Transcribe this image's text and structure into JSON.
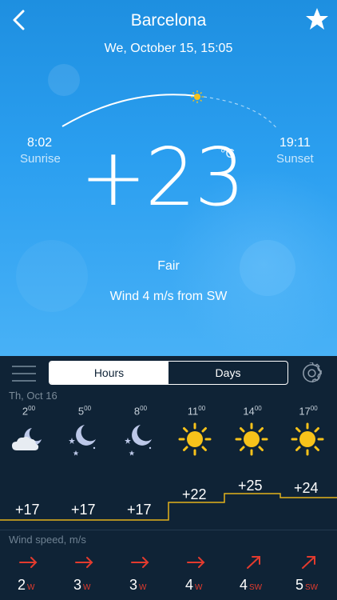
{
  "header": {
    "city": "Barcelona",
    "date_time": "We, October 15, 15:05"
  },
  "sun": {
    "sunrise_time": "8:02",
    "sunrise_label": "Sunrise",
    "sunset_time": "19:11",
    "sunset_label": "Sunset"
  },
  "current": {
    "temperature": "+23",
    "unit": "°C",
    "condition": "Fair",
    "wind": "Wind 4 m/s from SW"
  },
  "tabs": {
    "hours": "Hours",
    "days": "Days",
    "active": "Hours"
  },
  "forecast": {
    "day_label": "Th, Oct 16",
    "hours": [
      {
        "hour": "2",
        "sup": "00",
        "icon": "cloudy-night-icon",
        "temp": "+17",
        "wind_speed": "2",
        "wind_dir": "W"
      },
      {
        "hour": "5",
        "sup": "00",
        "icon": "clear-night-icon",
        "temp": "+17",
        "wind_speed": "3",
        "wind_dir": "W"
      },
      {
        "hour": "8",
        "sup": "00",
        "icon": "clear-night-icon",
        "temp": "+17",
        "wind_speed": "3",
        "wind_dir": "W"
      },
      {
        "hour": "11",
        "sup": "00",
        "icon": "sun-icon",
        "temp": "+22",
        "wind_speed": "4",
        "wind_dir": "W"
      },
      {
        "hour": "14",
        "sup": "00",
        "icon": "sun-icon",
        "temp": "+25",
        "wind_speed": "4",
        "wind_dir": "SW"
      },
      {
        "hour": "17",
        "sup": "00",
        "icon": "sun-icon",
        "temp": "+24",
        "wind_speed": "5",
        "wind_dir": "SW"
      }
    ],
    "wind_label": "Wind speed, m/s"
  },
  "colors": {
    "sky_top": "#1e8fe0",
    "panel": "#0f2336",
    "temp_line": "#e3b21b",
    "wind_arrow": "#e33b2e",
    "sun": "#f7c21a"
  }
}
